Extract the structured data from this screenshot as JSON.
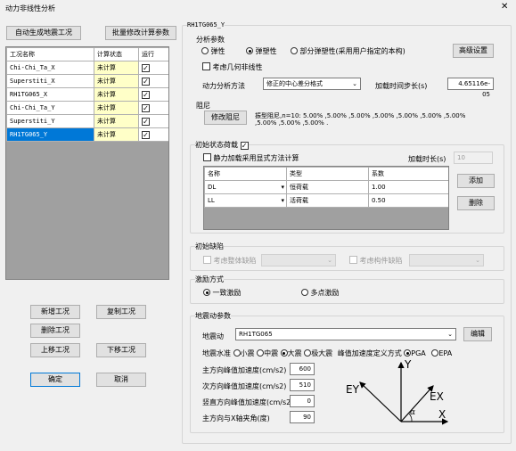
{
  "window": {
    "title": "动力非线性分析",
    "close_glyph": "✕"
  },
  "left": {
    "auto_gen_label": "自动生成地震工况",
    "batch_label": "批量修改计算参数",
    "table": {
      "headers": [
        "工况名称",
        "计算状态",
        "运行"
      ],
      "rows": [
        {
          "name": "Chi-Chi_Ta_X",
          "status": "未计算",
          "run": "✓"
        },
        {
          "name": "Superstiti_X",
          "status": "未计算",
          "run": "✓"
        },
        {
          "name": "RH1TG065_X",
          "status": "未计算",
          "run": "✓"
        },
        {
          "name": "Chi-Chi_Ta_Y",
          "status": "未计算",
          "run": "✓"
        },
        {
          "name": "Superstiti_Y",
          "status": "未计算",
          "run": "✓"
        },
        {
          "name": "RH1TG065_Y",
          "status": "未计算",
          "run": "✓"
        }
      ]
    },
    "add_label": "新增工况",
    "copy_label": "复制工况",
    "delete_label": "删除工况",
    "up_label": "上移工况",
    "down_label": "下移工况",
    "ok_label": "确定",
    "cancel_label": "取消"
  },
  "right": {
    "case_title": "RH1TG065_Y",
    "analysis": {
      "group_label": "分析参数",
      "opt_elastic": "弹性",
      "opt_plastic": "弹塑性",
      "opt_partial": "部分弹塑性(采用用户指定的本构)",
      "advanced_label": "高级设置",
      "geo_nl_label": "考虑几何非线性",
      "method_label": "动力分析方法",
      "method_value": "修正的中心差分格式",
      "step_label": "加载时间步长(s)",
      "step_value": "4.65116e-05"
    },
    "damping": {
      "group_label": "阻尼",
      "modify_label": "修改阻尼",
      "text1": "振型阻尼,n=10: 5.00% ,5.00% ,5.00% ,5.00% ,5.00% ,5.00% ,5.00%",
      "text2": ",5.00% ,5.00% ,5.00% ."
    },
    "initial": {
      "group_label": "初始状态荷载",
      "check": "✓",
      "static_label": "静力加载采用显式方法计算",
      "load_time_label": "加载时长(s)",
      "load_time_value": "10",
      "headers": [
        "名称",
        "类型",
        "系数"
      ],
      "rows": [
        {
          "name": "DL",
          "type": "恒荷载",
          "coef": "1.00"
        },
        {
          "name": "LL",
          "type": "活荷载",
          "coef": "0.50"
        }
      ],
      "add_label": "添加",
      "delete_label": "删除"
    },
    "defect": {
      "group_label": "初始缺陷",
      "global_label": "考虑整体缺陷",
      "member_label": "考虑构件缺陷"
    },
    "excitation": {
      "group_label": "激励方式",
      "opt_uniform": "一致激励",
      "opt_multi": "多点激励"
    },
    "seismic": {
      "group_label": "地震动参数",
      "wave_label": "地震动",
      "wave_value": "RH1TG065",
      "edit_label": "编辑",
      "level_label": "地震水准",
      "levels": [
        "小震",
        "中震",
        "大震",
        "极大震"
      ],
      "peak_def_label": "峰值加速度定义方式",
      "pga_label": "PGA",
      "epa_label": "EPA",
      "main_pga_label": "主方向峰值加速度(cm/s2)",
      "main_pga_value": "600",
      "sec_pga_label": "次方向峰值加速度(cm/s2)",
      "sec_pga_value": "510",
      "vert_pga_label": "竖直方向峰值加速度(cm/s2)",
      "vert_pga_value": "0",
      "angle_label": "主方向与X轴夹角(度)",
      "angle_value": "90",
      "diagram": {
        "y": "Y",
        "x": "X",
        "ey": "EY",
        "ex": "EX",
        "alpha": "α"
      }
    }
  }
}
